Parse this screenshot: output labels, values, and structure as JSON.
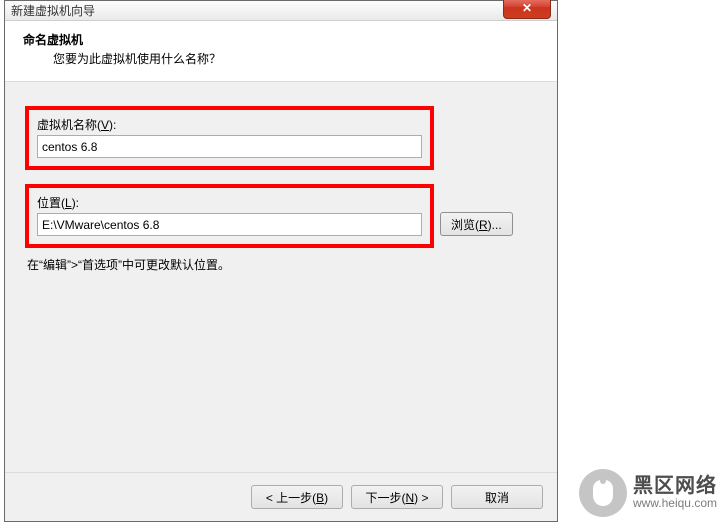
{
  "window": {
    "title": "新建虚拟机向导",
    "close_symbol": "✕"
  },
  "header": {
    "title": "命名虚拟机",
    "subtitle": "您要为此虚拟机使用什么名称？"
  },
  "vm_name": {
    "label_prefix": "虚拟机名称(",
    "label_accel": "V",
    "label_suffix": "):",
    "value": "centos 6.8"
  },
  "location": {
    "label_prefix": "位置(",
    "label_accel": "L",
    "label_suffix": "):",
    "value": "E:\\VMware\\centos 6.8"
  },
  "browse": {
    "prefix": "浏览(",
    "accel": "R",
    "suffix": ")..."
  },
  "hint": "在“编辑”>“首选项”中可更改默认位置。",
  "footer": {
    "back_prefix": "< 上一步(",
    "back_accel": "B",
    "back_suffix": ")",
    "next_prefix": "下一步(",
    "next_accel": "N",
    "next_suffix": ") >",
    "cancel": "取消"
  },
  "watermark": {
    "cn": "黑区网络",
    "url": "www.heiqu.com"
  }
}
